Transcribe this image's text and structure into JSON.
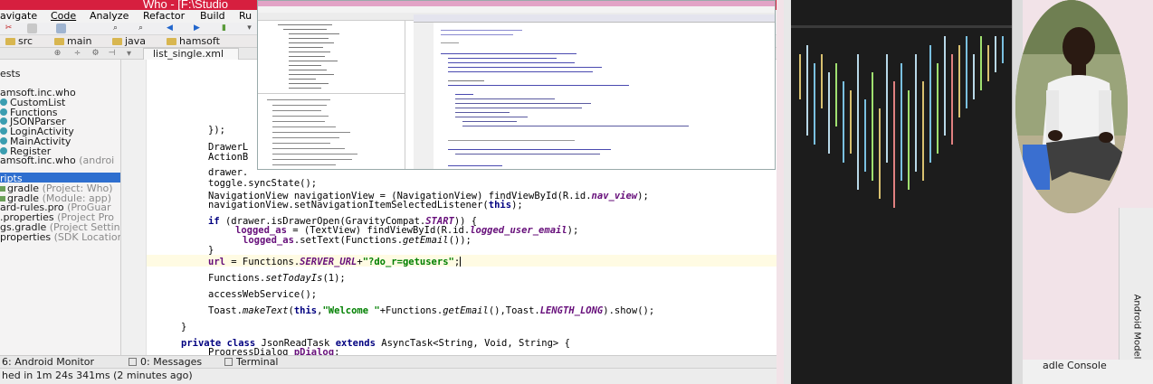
{
  "window": {
    "title": "Who - [F:\\Studio"
  },
  "menu": [
    "avigate",
    "Code",
    "Analyze",
    "Refactor",
    "Build",
    "Ru"
  ],
  "breadcrumbs": [
    "src",
    "main",
    "java",
    "hamsoft"
  ],
  "editor_tab": "list_single.xml",
  "project_tree": [
    {
      "text": "ests",
      "sub": ""
    },
    {
      "text": "amsoft.inc.who",
      "sub": ""
    },
    {
      "text": "CustomList",
      "sub": ""
    },
    {
      "text": "Functions",
      "sub": ""
    },
    {
      "text": "JSONParser",
      "sub": ""
    },
    {
      "text": "LoginActivity",
      "sub": ""
    },
    {
      "text": "MainActivity",
      "sub": ""
    },
    {
      "text": "Register",
      "sub": ""
    },
    {
      "text": "amsoft.inc.who",
      "sub": "(androi"
    },
    {
      "text": "ripts",
      "sub": ""
    },
    {
      "text": "gradle",
      "sub": "(Project: Who)"
    },
    {
      "text": "gradle",
      "sub": "(Module: app)"
    },
    {
      "text": "ard-rules.pro",
      "sub": "(ProGuar"
    },
    {
      "text": ".properties",
      "sub": "(Project Pro"
    },
    {
      "text": "gs.gradle",
      "sub": "(Project Settin"
    },
    {
      "text": "properties",
      "sub": "(SDK Location"
    }
  ],
  "code": {
    "l1": "});",
    "l2": "DrawerL",
    "l3": "ActionB",
    "l4": "drawer.",
    "l5": "toggle.syncState();",
    "l6a": "NavigationView navigationView = (NavigationView) findViewById(R.id.",
    "l6b": "nav_view",
    "l6c": ");",
    "l7a": "navigationView.setNavigationItemSelectedListener(",
    "l7b": "this",
    "l7c": ");",
    "l8a": "if",
    "l8b": " (drawer.isDrawerOpen(GravityCompat.",
    "l8c": "START",
    "l8d": ")) {",
    "l9a": "logged_as",
    "l9b": " = (TextView) findViewById(R.id.",
    "l9c": "logged_user_email",
    "l9d": ");",
    "l10a": "logged_as",
    "l10b": ".setText(Functions.",
    "l10c": "getEmail",
    "l10d": "());",
    "l11": "}",
    "l12a": "url",
    "l12b": " = Functions.",
    "l12c": "SERVER_URL",
    "l12d": "+",
    "l12e": "\"?do_r=getusers\"",
    "l12f": ";",
    "l13a": "Functions.",
    "l13b": "setTodayIs",
    "l13c": "(1);",
    "l14": "accessWebService();",
    "l15a": "Toast.",
    "l15b": "makeText",
    "l15c": "(",
    "l15d": "this",
    "l15e": ",",
    "l15f": "\"Welcome \"",
    "l15g": "+Functions.",
    "l15h": "getEmail",
    "l15i": "(),Toast.",
    "l15j": "LENGTH_LONG",
    "l15k": ").show();",
    "l16": "}",
    "l17a": "private class",
    "l17b": " JsonReadTask ",
    "l17c": "extends",
    "l17d": " AsyncTask<String, Void, String> {",
    "l18a": "ProgressDialog ",
    "l18b": "pDialog",
    "l18c": ";"
  },
  "bottom_tabs": [
    "6: Android Monitor",
    "0: Messages",
    "Terminal"
  ],
  "status": "hed in 1m 24s 341ms (2 minutes ago)",
  "right_panel": {
    "gradle_console": "adle Console",
    "android_model": "Android Model"
  },
  "colors": {
    "title_bar": "#d61f3f",
    "selection": "#2f6fcf",
    "keyword": "#000080",
    "string": "#008000",
    "field": "#660e7a"
  }
}
